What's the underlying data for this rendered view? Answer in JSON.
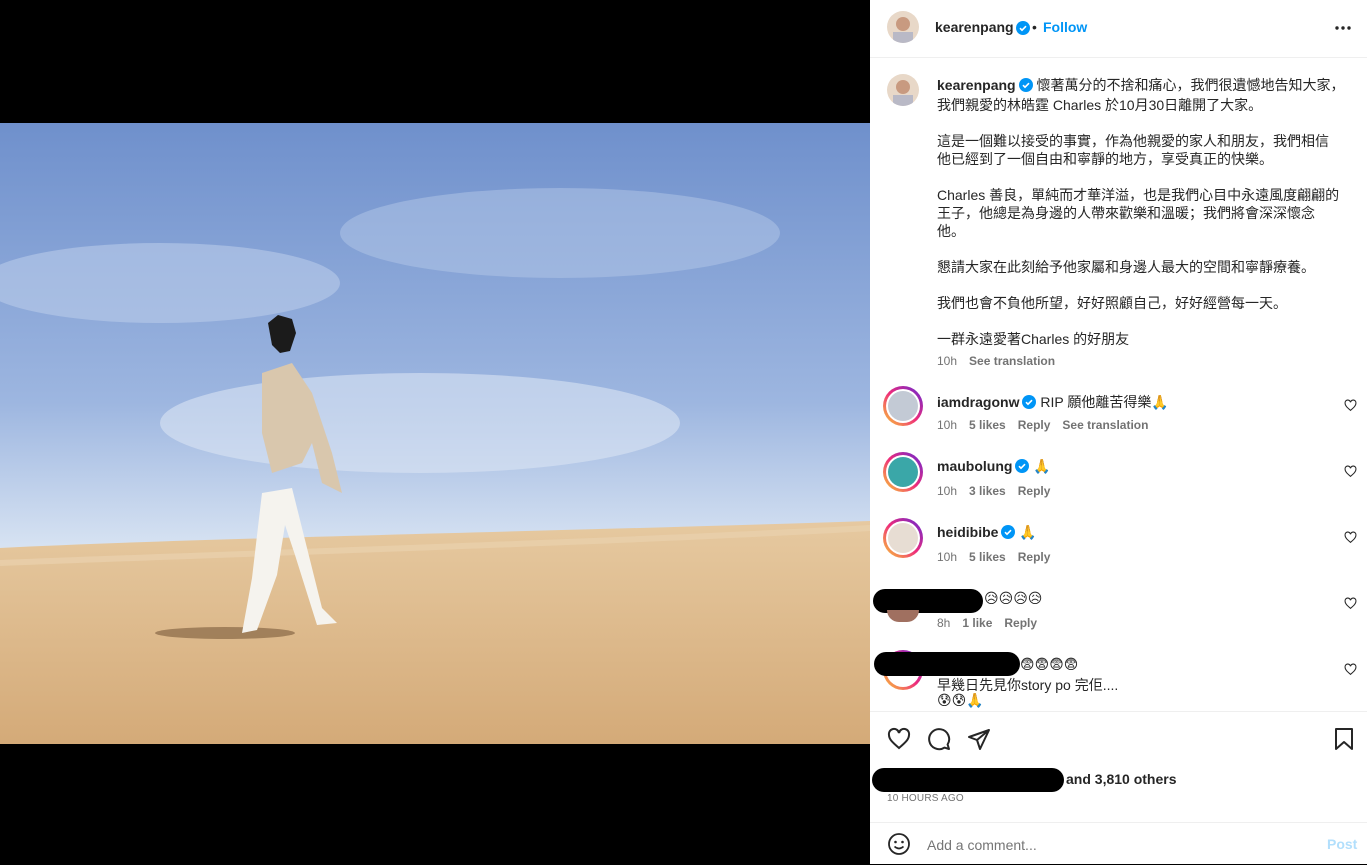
{
  "post": {
    "author": "kearenpang",
    "follow_label": "Follow",
    "dot": "•",
    "caption_lines": [
      "懷著萬分的不捨和痛心，我們很遺憾地告知大家，",
      "我們親愛的林皓霆 Charles 於10月30日離開了大家。",
      "這是一個難以接受的事實，作為他親愛的家人和朋友，我們相信",
      "他已經到了一個自由和寧靜的地方，享受真正的快樂。",
      "Charles 善良，單純而才華洋溢，也是我們心目中永遠風度翩翩的",
      "王子，他總是為身邊的人帶來歡樂和溫暖；我們將會深深懷念",
      "他。",
      "懇請大家在此刻給予他家屬和身邊人最大的空間和寧靜療養。",
      "我們也會不負他所望，好好照顧自己，好好經營每一天。",
      "一群永遠愛著Charles 的好朋友"
    ],
    "caption_time": "10h",
    "see_translation": "See translation"
  },
  "comments": [
    {
      "user": "iamdragonw",
      "text": "RIP 願他離苦得樂🙏",
      "time": "10h",
      "likes": "5 likes",
      "reply": "Reply",
      "translation": "See translation"
    },
    {
      "user": "maubolung",
      "text": "🙏",
      "time": "10h",
      "likes": "3 likes",
      "reply": "Reply"
    },
    {
      "user": "heidibibe",
      "text": "🙏",
      "time": "10h",
      "likes": "5 likes",
      "reply": "Reply"
    },
    {
      "text": "😥😥😥😥",
      "time": "8h",
      "likes": "1 like",
      "reply": "Reply"
    },
    {
      "text": "😨😨😨😨",
      "line2": "早幾日先見你story po 完佢....",
      "line3": "😰😰🙏"
    }
  ],
  "likes_text": "and 3,810 others",
  "timestamp": "10 HOURS AGO",
  "comment_box": {
    "placeholder": "Add a comment...",
    "post_label": "Post"
  },
  "colors": {
    "accent": "#0095f6",
    "verified": "#0095f6",
    "sky_top": "#7d9ad0",
    "sand": "#d8b384"
  }
}
